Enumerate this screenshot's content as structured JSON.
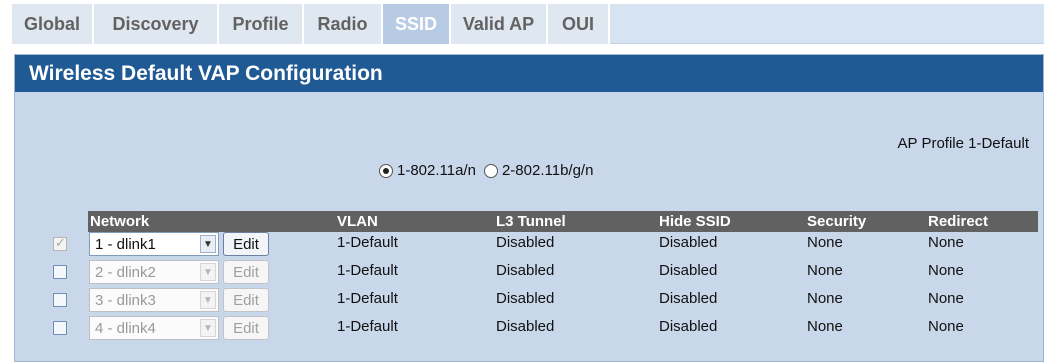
{
  "tabs": [
    {
      "label": "Global",
      "active": false
    },
    {
      "label": "Discovery",
      "active": false
    },
    {
      "label": "Profile",
      "active": false
    },
    {
      "label": "Radio",
      "active": false
    },
    {
      "label": "SSID",
      "active": true
    },
    {
      "label": "Valid AP",
      "active": false
    },
    {
      "label": "OUI",
      "active": false
    }
  ],
  "panel": {
    "title": "Wireless Default VAP Configuration",
    "profile_label": "AP Profile 1-Default"
  },
  "radio": {
    "option1_label": "1-802.11a/n",
    "option1_selected": true,
    "option2_label": "2-802.11b/g/n",
    "option2_selected": false
  },
  "table": {
    "headers": {
      "network": "Network",
      "vlan": "VLAN",
      "l3tunnel": "L3 Tunnel",
      "hide_ssid": "Hide SSID",
      "security": "Security",
      "redirect": "Redirect"
    },
    "edit_label": "Edit",
    "rows": [
      {
        "checked": true,
        "enabled": true,
        "network": "1 - dlink1",
        "vlan": "1-Default",
        "l3tunnel": "Disabled",
        "hide_ssid": "Disabled",
        "security": "None",
        "redirect": "None"
      },
      {
        "checked": false,
        "enabled": false,
        "network": "2 - dlink2",
        "vlan": "1-Default",
        "l3tunnel": "Disabled",
        "hide_ssid": "Disabled",
        "security": "None",
        "redirect": "None"
      },
      {
        "checked": false,
        "enabled": false,
        "network": "3 - dlink3",
        "vlan": "1-Default",
        "l3tunnel": "Disabled",
        "hide_ssid": "Disabled",
        "security": "None",
        "redirect": "None"
      },
      {
        "checked": false,
        "enabled": false,
        "network": "4 - dlink4",
        "vlan": "1-Default",
        "l3tunnel": "Disabled",
        "hide_ssid": "Disabled",
        "security": "None",
        "redirect": "None"
      }
    ]
  }
}
